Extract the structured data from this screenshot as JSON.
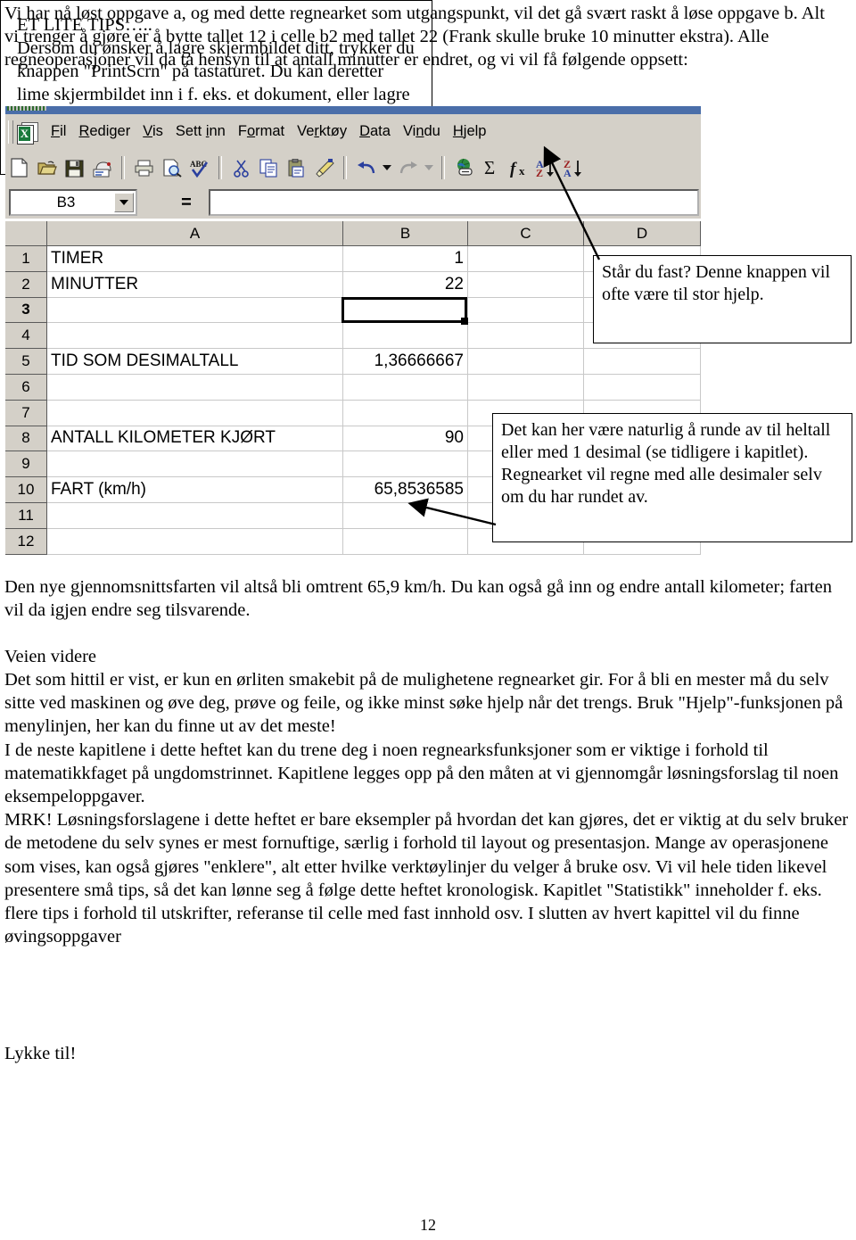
{
  "document": {
    "page_number": "12",
    "intro_paragraph": "Vi har nå løst oppgave a, og med dette regnearket som utgangspunkt, vil det gå svært raskt å løse oppgave b. Alt vi trenger å gjøre er å bytte tallet 12 i celle b2 med tallet 22 (Frank skulle bruke 10 minutter ekstra). Alle regneoperasjoner vil da ta hensyn til at antall minutter er endret, og vi vil få følgende oppsett:",
    "result_paragraph": "Den nye gjennomsnittsfarten vil altså bli omtrent 65,9 km/h. Du kan også gå inn og endre antall kilometer; farten vil da igjen endre seg tilsvarende.",
    "section_heading": "Veien videre",
    "body_paragraphs": [
      "Det som hittil er vist, er kun en ørliten smakebit på de mulighetene regnearket gir. For å bli en mester må du selv sitte ved maskinen og øve deg, prøve og feile, og ikke minst søke hjelp når det trengs. Bruk \"Hjelp\"-funksjonen på menylinjen, her kan du finne ut av det meste!",
      "I de neste kapitlene i dette heftet kan du trene deg i noen regnearksfunksjoner som er viktige i forhold til matematikkfaget på ungdomstrinnet. Kapitlene legges opp på den måten at vi gjennomgår løsningsforslag til noen eksempeloppgaver.",
      "MRK! Løsningsforslagene i dette heftet er bare eksempler på hvordan det kan gjøres, det er viktig at du selv bruker de metodene du selv synes er mest fornuftige, særlig i forhold til layout og presentasjon. Mange av operasjonene som vises, kan også gjøres \"enklere\", alt etter hvilke verktøylinjer du velger å bruke osv. Vi vil hele tiden likevel presentere små tips, så det kan lønne seg å følge dette heftet kronologisk. Kapitlet \"Statistikk\" inneholder f. eks. flere tips i forhold til utskrifter, referanse til celle med fast innhold osv. I slutten av hvert kapittel vil du finne øvingsoppgaver"
    ],
    "closing": "Lykke til!"
  },
  "spreadsheet": {
    "menu_items": [
      {
        "label": "Fil",
        "mnemonic_index": 0
      },
      {
        "label": "Rediger",
        "mnemonic_index": 0
      },
      {
        "label": "Vis",
        "mnemonic_index": 0
      },
      {
        "label": "Sett inn",
        "mnemonic_index": 5
      },
      {
        "label": "Format",
        "mnemonic_index": 2
      },
      {
        "label": "Verktøy",
        "mnemonic_index": 2
      },
      {
        "label": "Data",
        "mnemonic_index": 0
      },
      {
        "label": "Vindu",
        "mnemonic_index": 2
      },
      {
        "label": "Hjelp",
        "mnemonic_index": 0
      }
    ],
    "toolbar_icons": [
      "new-document-icon",
      "open-folder-icon",
      "save-disk-icon",
      "email-icon",
      "print-icon",
      "print-preview-icon",
      "spelling-check-icon",
      "cut-scissors-icon",
      "copy-icon",
      "paste-clipboard-icon",
      "format-painter-icon",
      "undo-icon",
      "undo-dropdown-icon",
      "redo-icon",
      "redo-dropdown-icon",
      "insert-hyperlink-icon",
      "autosum-icon",
      "paste-function-icon",
      "sort-ascending-icon",
      "sort-descending-icon"
    ],
    "name_box_value": "B3",
    "formula_bar_value": "",
    "equals_symbol": "=",
    "column_headers": [
      "A",
      "B",
      "C",
      "D"
    ],
    "row_headers": [
      "1",
      "2",
      "3",
      "4",
      "5",
      "6",
      "7",
      "8",
      "9",
      "10",
      "11",
      "12"
    ],
    "selected_cell": "B3",
    "rows": [
      {
        "num": "1",
        "a": "TIMER",
        "b": "1",
        "c": "",
        "d": ""
      },
      {
        "num": "2",
        "a": "MINUTTER",
        "b": "22",
        "c": "",
        "d": ""
      },
      {
        "num": "3",
        "a": "",
        "b": "",
        "c": "",
        "d": ""
      },
      {
        "num": "4",
        "a": "",
        "b": "",
        "c": "",
        "d": ""
      },
      {
        "num": "5",
        "a": "TID SOM DESIMALTALL",
        "b": "1,36666667",
        "c": "",
        "d": ""
      },
      {
        "num": "6",
        "a": "",
        "b": "",
        "c": "",
        "d": ""
      },
      {
        "num": "7",
        "a": "",
        "b": "",
        "c": "",
        "d": ""
      },
      {
        "num": "8",
        "a": "ANTALL KILOMETER KJØRT",
        "b": "90",
        "c": "",
        "d": ""
      },
      {
        "num": "9",
        "a": "",
        "b": "",
        "c": "",
        "d": ""
      },
      {
        "num": "10",
        "a": "FART (km/h)",
        "b": "65,8536585",
        "c": "",
        "d": ""
      },
      {
        "num": "11",
        "a": "",
        "b": "",
        "c": "",
        "d": ""
      },
      {
        "num": "12",
        "a": "",
        "b": "",
        "c": "",
        "d": ""
      }
    ]
  },
  "callouts": {
    "help_button": "Står du fast? Denne knappen vil ofte være til stor hjelp.",
    "rounding": "Det kan her være naturlig å runde av til heltall eller med 1 desimal (se tidligere i kapitlet). Regnearket vil regne med alle desimaler selv om du har rundet av."
  },
  "tip_box": {
    "title": "ET LITE TIPS…..",
    "text": "Dersom du ønsker å lagre skjermbildet ditt, trykker du knappen \"PrintScrn\" på tastaturet. Du kan deretter lime skjermbildet inn i f. eks. et dokument, eller lagre det som et bilde."
  },
  "colors": {
    "titlebar": "#4a6ea9",
    "chrome": "#d4d0c8",
    "grid_line": "#c8c8c8",
    "header_border": "#5a5a5a"
  }
}
